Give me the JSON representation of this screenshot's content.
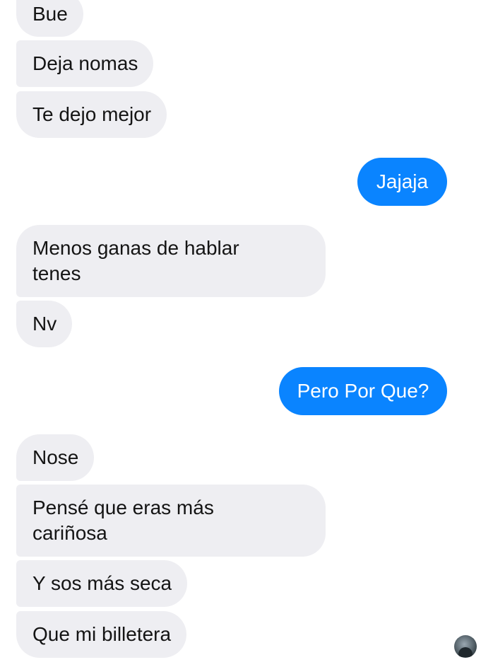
{
  "conversation": {
    "messages": [
      {
        "sender": "other",
        "text": "Bue"
      },
      {
        "sender": "other",
        "text": "Deja nomas"
      },
      {
        "sender": "other",
        "text": "Te dejo mejor"
      },
      {
        "sender": "me",
        "text": "Jajaja"
      },
      {
        "sender": "other",
        "text": "Menos ganas de hablar tenes"
      },
      {
        "sender": "other",
        "text": "Nv"
      },
      {
        "sender": "me",
        "text": "Pero Por Que?"
      },
      {
        "sender": "other",
        "text": "Nose"
      },
      {
        "sender": "other",
        "text": "Pensé que eras más cariñosa"
      },
      {
        "sender": "other",
        "text": "Y sos más seca"
      },
      {
        "sender": "other",
        "text": "Que mi billetera"
      }
    ]
  },
  "colors": {
    "incoming_bubble": "#eeeef2",
    "outgoing_bubble": "#0a84ff",
    "background": "#ffffff"
  },
  "icons": {
    "read_receipt": "avatar-icon"
  }
}
